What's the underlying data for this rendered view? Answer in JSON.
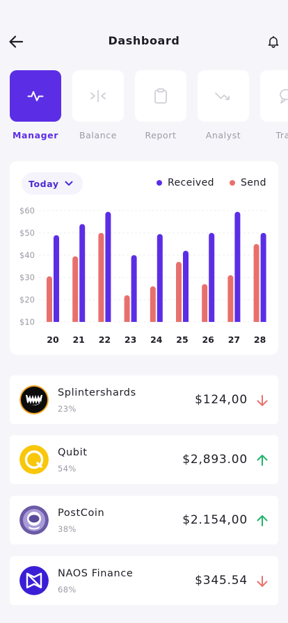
{
  "header": {
    "title": "Dashboard"
  },
  "tabs": [
    {
      "label": "Manager",
      "icon": "activity-icon",
      "active": true
    },
    {
      "label": "Balance",
      "icon": "split-icon",
      "active": false
    },
    {
      "label": "Report",
      "icon": "clipboard-icon",
      "active": false
    },
    {
      "label": "Analyst",
      "icon": "trend-down-icon",
      "active": false
    },
    {
      "label": "Trad",
      "icon": "chat-icon",
      "active": false
    }
  ],
  "chart_section": {
    "period_label": "Today",
    "legend": [
      {
        "label": "Received",
        "color": "#5b2ee6"
      },
      {
        "label": "Send",
        "color": "#e8706c"
      }
    ]
  },
  "chart_data": {
    "type": "bar",
    "categories": [
      "20",
      "21",
      "22",
      "23",
      "24",
      "25",
      "26",
      "27",
      "28"
    ],
    "y_ticks": [
      "$60",
      "$50",
      "$40",
      "$30",
      "$20",
      "$10"
    ],
    "ylim": [
      10,
      60
    ],
    "grid": true,
    "legend_position": "top-right",
    "series": [
      {
        "name": "Send",
        "color": "#e8706c",
        "values": [
          30.5,
          39.5,
          50,
          22,
          26,
          37,
          27,
          31,
          45
        ]
      },
      {
        "name": "Received",
        "color": "#5b2ee6",
        "values": [
          49,
          54,
          59.5,
          40,
          49.5,
          42,
          50,
          59.5,
          50
        ]
      }
    ]
  },
  "assets": [
    {
      "name": "Splintershards",
      "pct": "23%",
      "amount": "$124,00",
      "direction": "down",
      "icon": "splintershards-logo-icon"
    },
    {
      "name": "Qubit",
      "pct": "54%",
      "amount": "$2,893.00",
      "direction": "up",
      "icon": "qubit-logo-icon"
    },
    {
      "name": "PostCoin",
      "pct": "38%",
      "amount": "$2.154,00",
      "direction": "up",
      "icon": "postcoin-logo-icon"
    },
    {
      "name": "NAOS Finance",
      "pct": "68%",
      "amount": "$345.54",
      "direction": "down",
      "icon": "naos-logo-icon"
    }
  ],
  "colors": {
    "accent": "#5b2ee6",
    "up": "#21b36b",
    "down": "#e8706c"
  }
}
